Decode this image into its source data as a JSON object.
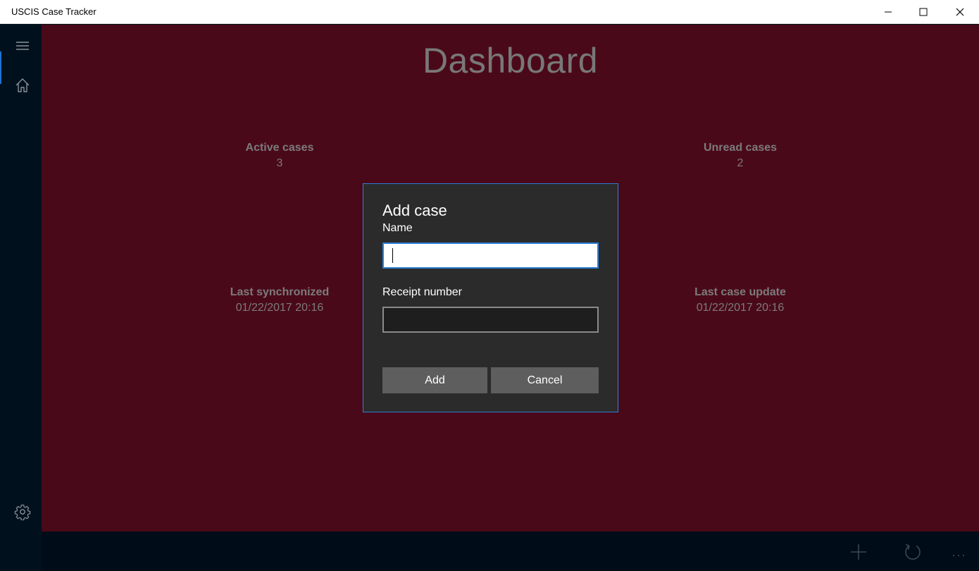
{
  "window": {
    "title": "USCIS Case Tracker",
    "controls": [
      "minimize",
      "maximize",
      "close"
    ]
  },
  "nav": {
    "items": [
      {
        "icon": "hamburger-menu-icon"
      },
      {
        "icon": "home-icon"
      },
      {
        "icon": "gear-icon"
      }
    ]
  },
  "dashboard": {
    "title": "Dashboard",
    "active_cases": {
      "label": "Active cases",
      "value": "3"
    },
    "unread_cases": {
      "label": "Unread cases",
      "value": "2"
    },
    "last_synchronized": {
      "label": "Last synchronized",
      "value": "01/22/2017 20:16"
    },
    "last_case_update": {
      "label": "Last case update",
      "value": "01/22/2017 20:16"
    }
  },
  "dialog": {
    "title": "Add case",
    "name_label": "Name",
    "name_value": "",
    "receipt_label": "Receipt number",
    "receipt_value": "",
    "add_label": "Add",
    "cancel_label": "Cancel"
  },
  "command_bar": {
    "items": [
      {
        "icon": "add-icon"
      },
      {
        "icon": "refresh-icon"
      },
      {
        "icon": "more-icon",
        "label": "..."
      }
    ]
  },
  "colors": {
    "content_background": "#4a0919",
    "nav_background": "#00111d",
    "dialog_background": "#2b2b2b",
    "accent": "#2d7fd6"
  }
}
